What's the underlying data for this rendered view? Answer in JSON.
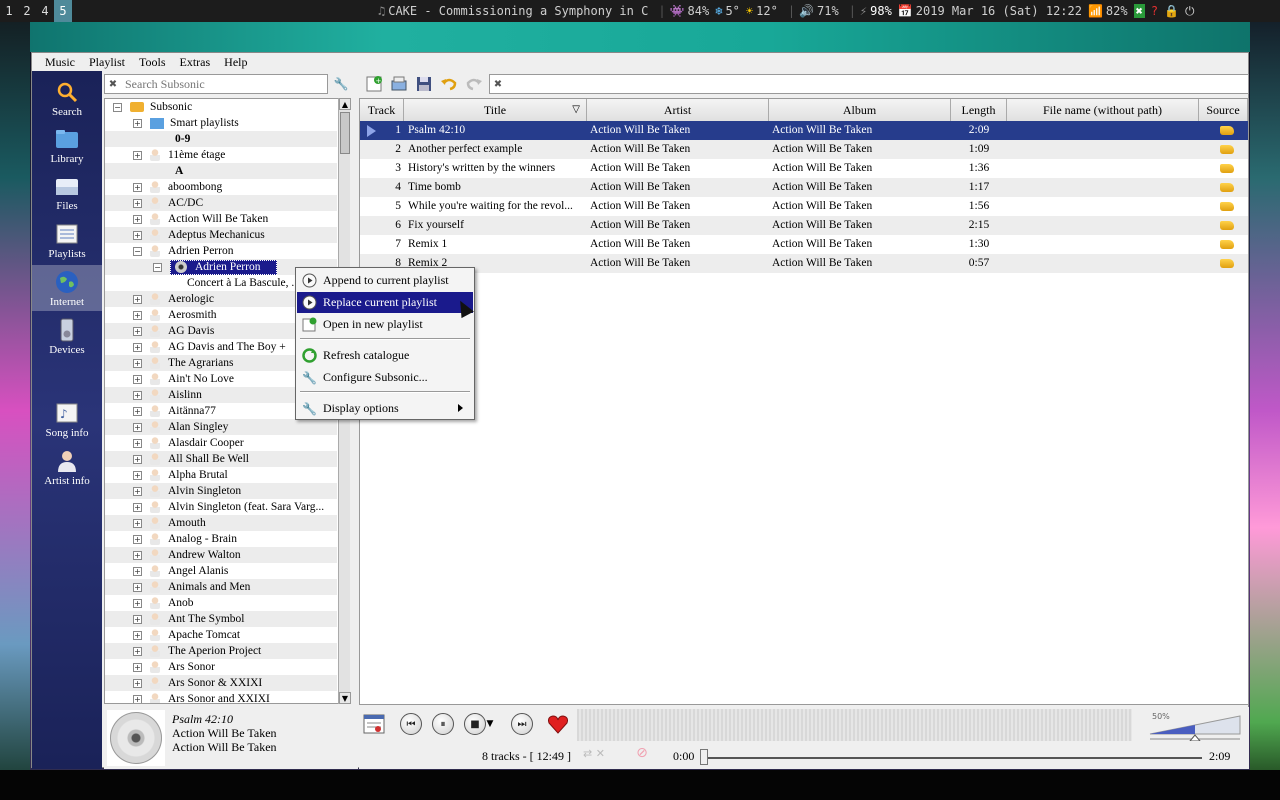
{
  "topbar": {
    "workspaces": [
      "1",
      "2",
      "4",
      "5"
    ],
    "active_workspace": "5",
    "now_playing": "CAKE - Commissioning a Symphony in C",
    "cpu": "84%",
    "weather_cold": "5°",
    "weather_sun": "12°",
    "volume": "71%",
    "battery": "98%",
    "datetime": "2019 Mar 16 (Sat) 12:22",
    "wifi": "82%"
  },
  "menubar": [
    "Music",
    "Playlist",
    "Tools",
    "Extras",
    "Help"
  ],
  "sidebar": [
    {
      "label": "Search",
      "icon": "search-icon"
    },
    {
      "label": "Library",
      "icon": "library-icon"
    },
    {
      "label": "Files",
      "icon": "files-icon"
    },
    {
      "label": "Playlists",
      "icon": "playlists-icon"
    },
    {
      "label": "Internet",
      "icon": "globe-icon"
    },
    {
      "label": "Devices",
      "icon": "devices-icon"
    },
    {
      "label": "Song info",
      "icon": "song-info-icon"
    },
    {
      "label": "Artist info",
      "icon": "artist-info-icon"
    }
  ],
  "search": {
    "placeholder": "Search Subsonic",
    "value": ""
  },
  "tree": {
    "root": "Subsonic",
    "rows": [
      {
        "text": "Smart playlists",
        "kind": "smart"
      },
      {
        "text": "0-9",
        "kind": "letter"
      },
      {
        "text": "11ème étage",
        "kind": "artist"
      },
      {
        "text": "A",
        "kind": "letter"
      },
      {
        "text": "aboombong",
        "kind": "artist"
      },
      {
        "text": "AC/DC",
        "kind": "artist"
      },
      {
        "text": "Action Will Be Taken",
        "kind": "artist"
      },
      {
        "text": "Adeptus Mechanicus",
        "kind": "artist"
      },
      {
        "text": "Adrien Perron",
        "kind": "artist-open"
      },
      {
        "text": "Adrien Perron",
        "kind": "album-selected"
      },
      {
        "text": "Concert à La Bascule, ...",
        "kind": "leaf"
      },
      {
        "text": "Aerologic",
        "kind": "artist"
      },
      {
        "text": "Aerosmith",
        "kind": "artist"
      },
      {
        "text": "AG Davis",
        "kind": "artist"
      },
      {
        "text": "AG Davis and The Boy +",
        "kind": "artist"
      },
      {
        "text": "The Agrarians",
        "kind": "artist"
      },
      {
        "text": "Ain't No Love",
        "kind": "artist"
      },
      {
        "text": "Aislinn",
        "kind": "artist"
      },
      {
        "text": "Aitänna77",
        "kind": "artist"
      },
      {
        "text": "Alan Singley",
        "kind": "artist"
      },
      {
        "text": "Alasdair Cooper",
        "kind": "artist"
      },
      {
        "text": "All Shall Be Well",
        "kind": "artist"
      },
      {
        "text": "Alpha Brutal",
        "kind": "artist"
      },
      {
        "text": "Alvin Singleton",
        "kind": "artist"
      },
      {
        "text": "Alvin Singleton (feat. Sara Varg...",
        "kind": "artist"
      },
      {
        "text": "Amouth",
        "kind": "artist"
      },
      {
        "text": "Analog - Brain",
        "kind": "artist"
      },
      {
        "text": "Andrew Walton",
        "kind": "artist"
      },
      {
        "text": "Angel Alanis",
        "kind": "artist"
      },
      {
        "text": "Animals and Men",
        "kind": "artist"
      },
      {
        "text": "Anob",
        "kind": "artist"
      },
      {
        "text": "Ant The Symbol",
        "kind": "artist"
      },
      {
        "text": "Apache Tomcat",
        "kind": "artist"
      },
      {
        "text": "The Aperion Project",
        "kind": "artist"
      },
      {
        "text": "Ars Sonor",
        "kind": "artist"
      },
      {
        "text": "Ars Sonor & XXIXI",
        "kind": "artist"
      },
      {
        "text": "Ars Sonor and XXIXI",
        "kind": "artist"
      }
    ]
  },
  "playlist": {
    "columns": [
      "Track",
      "Title",
      "Artist",
      "Album",
      "Length",
      "File name (without path)",
      "Source"
    ],
    "rows": [
      {
        "track": "1",
        "title": "Psalm 42:10",
        "artist": "Action Will Be Taken",
        "album": "Action Will Be Taken",
        "length": "2:09"
      },
      {
        "track": "2",
        "title": "Another perfect example",
        "artist": "Action Will Be Taken",
        "album": "Action Will Be Taken",
        "length": "1:09"
      },
      {
        "track": "3",
        "title": "History's written by the winners",
        "artist": "Action Will Be Taken",
        "album": "Action Will Be Taken",
        "length": "1:36"
      },
      {
        "track": "4",
        "title": "Time bomb",
        "artist": "Action Will Be Taken",
        "album": "Action Will Be Taken",
        "length": "1:17"
      },
      {
        "track": "5",
        "title": "While you're waiting for the revol...",
        "artist": "Action Will Be Taken",
        "album": "Action Will Be Taken",
        "length": "1:56"
      },
      {
        "track": "6",
        "title": "Fix yourself",
        "artist": "Action Will Be Taken",
        "album": "Action Will Be Taken",
        "length": "2:15"
      },
      {
        "track": "7",
        "title": "Remix 1",
        "artist": "Action Will Be Taken",
        "album": "Action Will Be Taken",
        "length": "1:30"
      },
      {
        "track": "8",
        "title": "Remix 2",
        "artist": "Action Will Be Taken",
        "album": "Action Will Be Taken",
        "length": "0:57"
      }
    ],
    "filter_value": ""
  },
  "context_menu": {
    "items": [
      {
        "label": "Append to current playlist",
        "icon": "play-circle-icon"
      },
      {
        "label": "Replace current playlist",
        "icon": "play-circle-icon"
      },
      {
        "label": "Open in new playlist",
        "icon": "new-playlist-icon"
      },
      {
        "label": "Refresh catalogue",
        "icon": "refresh-icon"
      },
      {
        "label": "Configure Subsonic...",
        "icon": "wrench-icon"
      },
      {
        "label": "Display options",
        "icon": "wrench-icon"
      }
    ],
    "highlighted": "Replace current playlist"
  },
  "now_playing": {
    "title": "Psalm 42:10",
    "artist": "Action Will Be Taken",
    "album": "Action Will Be Taken"
  },
  "player": {
    "track_summary": "8 tracks - [ 12:49 ]",
    "elapsed": "0:00",
    "total": "2:09",
    "volume_label": "50%",
    "volume_level": 0.5
  },
  "colors": {
    "selection": "#1a1a8c",
    "current_row": "#263c8c",
    "sidebar": "#1f2868"
  }
}
